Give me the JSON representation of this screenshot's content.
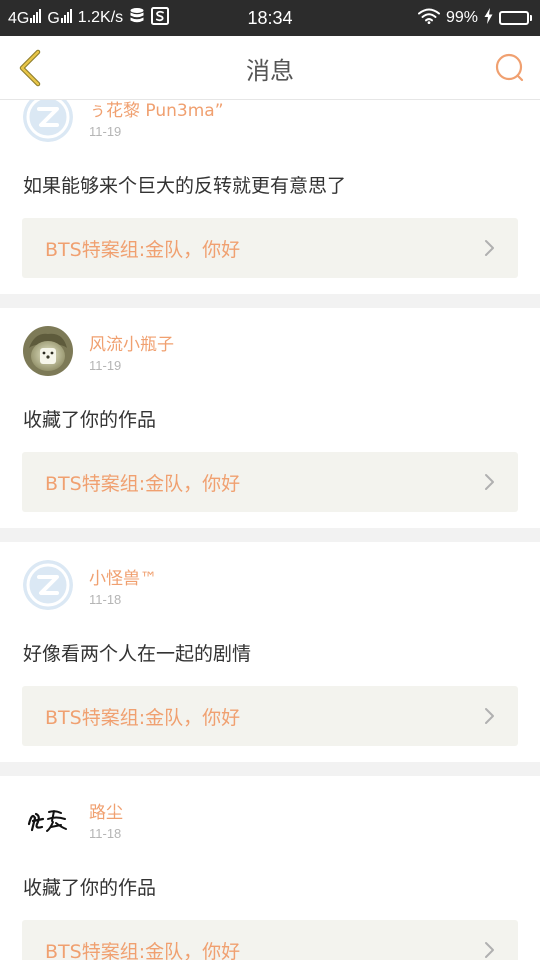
{
  "status_bar": {
    "network_left": "4G",
    "network_right": "G",
    "speed": "1.2K/s",
    "time": "18:34",
    "battery_percent": "99%",
    "battery_level": 0.99
  },
  "header": {
    "title": "消息"
  },
  "colors": {
    "accent": "#f0a070",
    "message_text": "#333333",
    "date_text": "#b5b5b5",
    "ref_background": "#f3f3ee",
    "page_background": "#f2f2f2"
  },
  "messages": [
    {
      "user": "ぅ花黎 Pun3ma”",
      "date": "11-19",
      "text": "如果能够来个巨大的反转就更有意思了",
      "ref": "BTS特案组:金队，你好",
      "avatar": "default-avatar-icon"
    },
    {
      "user": "风流小瓶子",
      "date": "11-19",
      "text": "收藏了你的作品",
      "ref": "BTS特案组:金队，你好",
      "avatar": "hedgehog-photo-avatar"
    },
    {
      "user": "小怪兽™",
      "date": "11-18",
      "text": "好像看两个人在一起的剧情",
      "ref": "BTS特案组:金队，你好",
      "avatar": "default-avatar-icon"
    },
    {
      "user": "路尘",
      "date": "11-18",
      "text": "收藏了你的作品",
      "ref": "BTS特案组:金队，你好",
      "avatar": "calligraphy-avatar"
    }
  ]
}
